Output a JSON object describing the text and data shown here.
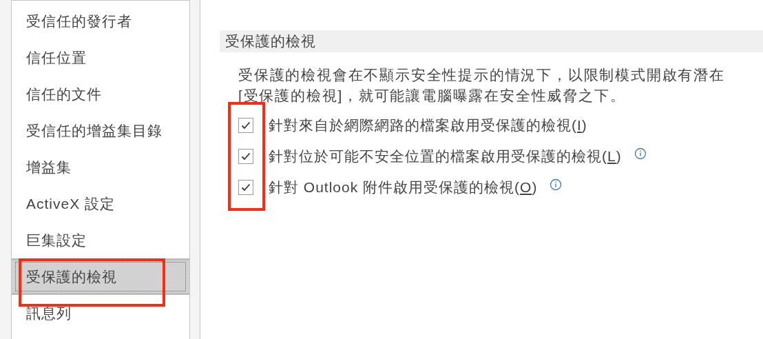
{
  "sidebar": {
    "items": [
      {
        "label": "受信任的發行者",
        "selected": false,
        "highlighted": false
      },
      {
        "label": "信任位置",
        "selected": false,
        "highlighted": false
      },
      {
        "label": "信任的文件",
        "selected": false,
        "highlighted": false
      },
      {
        "label": "受信任的增益集目錄",
        "selected": false,
        "highlighted": false
      },
      {
        "label": "增益集",
        "selected": false,
        "highlighted": false
      },
      {
        "label": "ActiveX 設定",
        "selected": false,
        "highlighted": false
      },
      {
        "label": "巨集設定",
        "selected": false,
        "highlighted": false
      },
      {
        "label": "受保護的檢視",
        "selected": true,
        "highlighted": true
      },
      {
        "label": "訊息列",
        "selected": false,
        "highlighted": false
      }
    ]
  },
  "section": {
    "title": "受保護的檢視",
    "description": [
      "受保護的檢視會在不顯示安全性提示的情況下，以限制模式開啟有潛在",
      "[受保護的檢視]，就可能讓電腦曝露在安全性威脅之下。"
    ],
    "options_highlighted": true,
    "options": [
      {
        "label_before": "針對來自於網際網路的檔案啟用受保護的檢視(",
        "accesskey": "I",
        "label_after": ")",
        "checked": true
      },
      {
        "label_before": "針對位於可能不安全位置的檔案啟用受保護的檢視(",
        "accesskey": "L",
        "label_after": ")",
        "checked": true,
        "info": true
      },
      {
        "label_before": "針對 Outlook 附件啟用受保護的檢視(",
        "accesskey": "O",
        "label_after": ")",
        "checked": true,
        "info": true
      }
    ]
  }
}
